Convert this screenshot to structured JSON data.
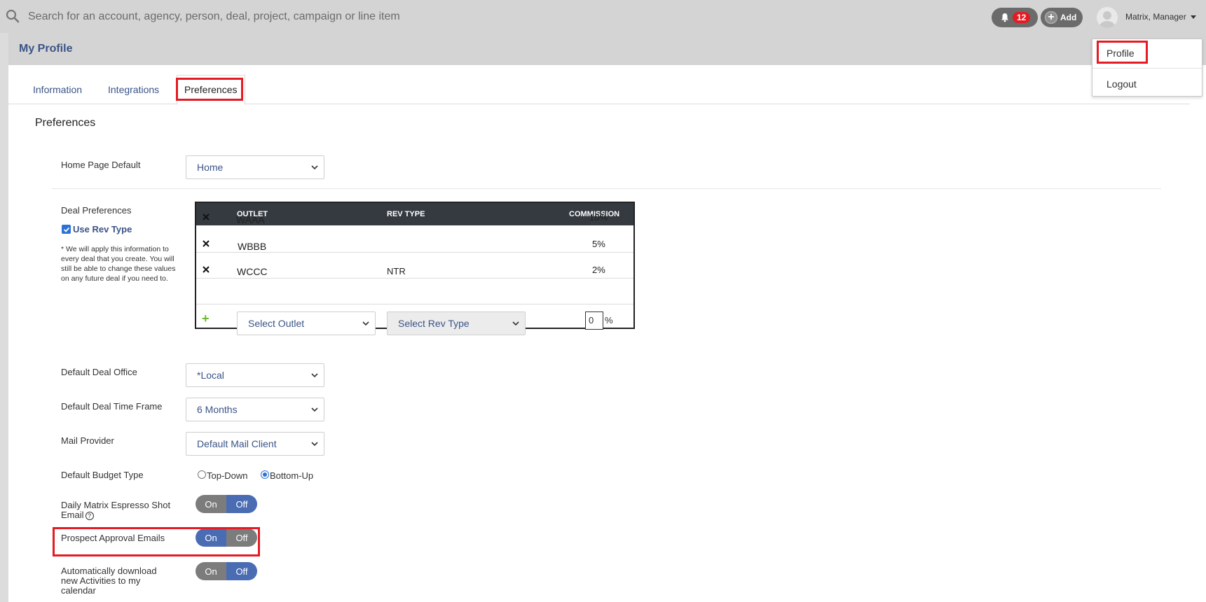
{
  "search": {
    "placeholder": "Search for an account, agency, person, deal, project, campaign or line item"
  },
  "header": {
    "notifications_count": "12",
    "add_label": "Add",
    "user_name": "Matrix, Manager",
    "user_menu": {
      "profile": "Profile",
      "logout": "Logout"
    }
  },
  "page": {
    "title": "My Profile"
  },
  "tabs": [
    {
      "label": "Information"
    },
    {
      "label": "Integrations"
    },
    {
      "label": "Preferences",
      "active": true
    }
  ],
  "preferences": {
    "section_title": "Preferences",
    "home_page_default": {
      "label": "Home Page Default",
      "value": "Home"
    },
    "deal_preferences": {
      "label": "Deal Preferences",
      "use_rev_type_label": "Use Rev Type",
      "use_rev_type_checked": true,
      "note": "* We will apply this information to every deal that you create. You will still be able to change these values on any future deal if you need to.",
      "columns": {
        "outlet": "OUTLET",
        "rev_type": "REV TYPE",
        "commission": "COMMISSION"
      },
      "rows": [
        {
          "outlet": "WAAA",
          "rev_type": "",
          "commission": "10%"
        },
        {
          "outlet": "WBBB",
          "rev_type": "",
          "commission": "5%"
        },
        {
          "outlet": "WCCC",
          "rev_type": "NTR",
          "commission": "2%"
        }
      ],
      "new_row": {
        "outlet_placeholder": "Select Outlet",
        "rev_type_placeholder": "Select Rev Type",
        "commission_value": "0",
        "percent_sign": "%"
      }
    },
    "default_deal_office": {
      "label": "Default Deal Office",
      "value": "*Local"
    },
    "default_deal_time_frame": {
      "label": "Default Deal Time Frame",
      "value": "6 Months"
    },
    "mail_provider": {
      "label": "Mail Provider",
      "value": "Default Mail Client"
    },
    "default_budget_type": {
      "label": "Default Budget Type",
      "options": [
        "Top-Down",
        "Bottom-Up"
      ],
      "selected": "Bottom-Up"
    },
    "espresso_shot": {
      "label_line1": "Daily Matrix Espresso Shot",
      "label_line2": "Email",
      "on": "On",
      "off": "Off",
      "value": "Off"
    },
    "prospect_approval": {
      "label": "Prospect Approval Emails",
      "on": "On",
      "off": "Off",
      "value": "On"
    },
    "auto_download": {
      "label_line1": "Automatically download",
      "label_line2": "new Activities to my",
      "label_line3": "calendar",
      "on": "On",
      "off": "Off",
      "value": "Off"
    }
  },
  "colors": {
    "accent": "#4a6cb3",
    "highlight": "#e41b23",
    "link": "#3a5487",
    "badge": "#e41b23"
  },
  "icons": [
    "search-icon",
    "bell-icon",
    "plus-circle-icon",
    "avatar",
    "caret-down-icon",
    "chevron-down-icon",
    "close-icon",
    "plus-icon",
    "help-icon"
  ]
}
